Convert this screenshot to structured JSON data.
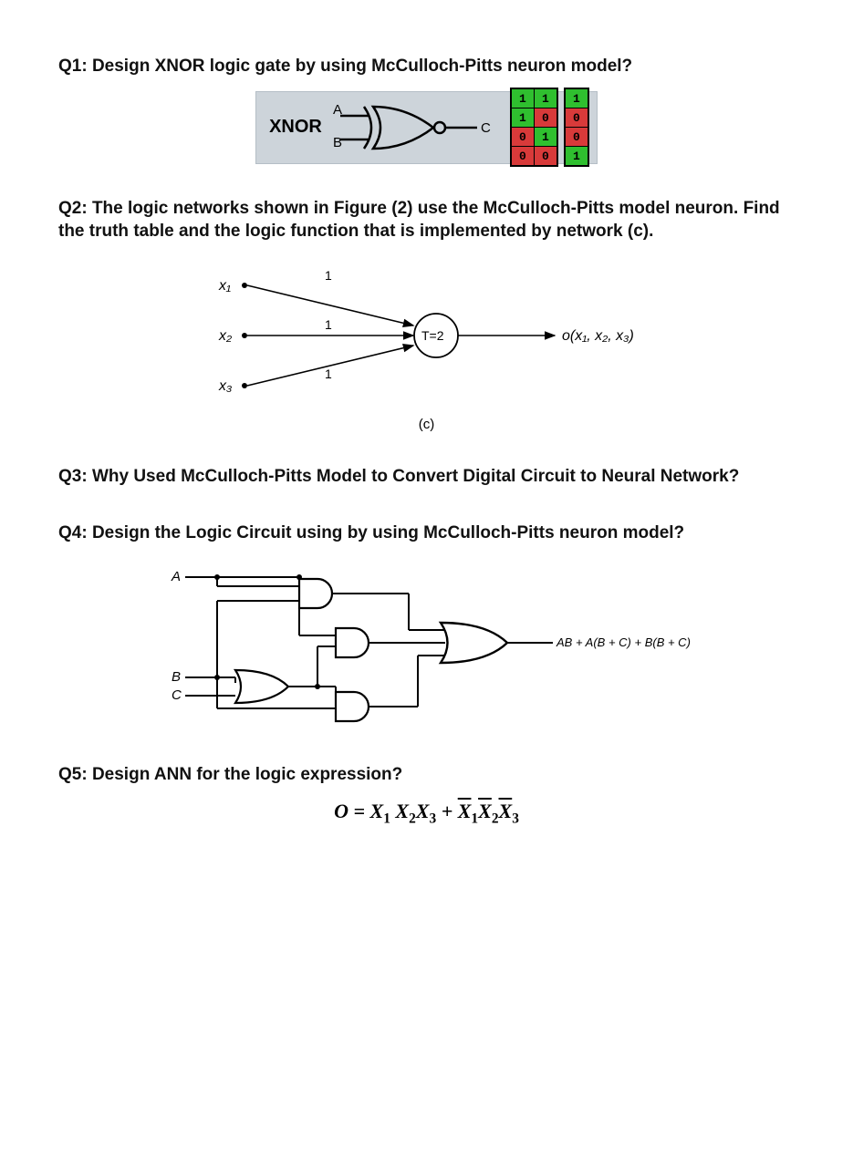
{
  "q1": {
    "title": "Q1: Design XNOR logic gate by using McCulloch-Pitts neuron model?",
    "label": "XNOR",
    "inputs": {
      "a": "A",
      "b": "B"
    },
    "output": "C",
    "truth_table": {
      "inputs_rows": [
        [
          "1",
          "1"
        ],
        [
          "1",
          "0"
        ],
        [
          "0",
          "1"
        ],
        [
          "0",
          "0"
        ]
      ],
      "output_rows": [
        "1",
        "0",
        "0",
        "1"
      ]
    }
  },
  "q2": {
    "title": "Q2: The logic networks shown in Figure (2) use the McCulloch-Pitts model neuron. Find the truth table and the logic function that is implemented by network (c).",
    "inputs": {
      "x1": "x₁",
      "x2": "x₂",
      "x3": "x₃"
    },
    "weights": {
      "w1": "1",
      "w2": "1",
      "w3": "1"
    },
    "threshold": "T=2",
    "output_label": "o(x₁, x₂, x₃)",
    "caption": "(c)"
  },
  "q3": {
    "title": "Q3: Why Used McCulloch-Pitts Model to Convert Digital Circuit to Neural Network?"
  },
  "q4": {
    "title": "Q4: Design the Logic Circuit using by using McCulloch-Pitts neuron model?",
    "inputs": {
      "a": "A",
      "b": "B",
      "c": "C"
    },
    "output_expr": "AB + A(B + C) + B(B + C)"
  },
  "q5": {
    "title": "Q5: Design ANN for the logic expression?",
    "expression_html": "O = X<sub>1</sub> X<sub>2</sub>X<sub>3</sub> + <span class=\"overbar\">X</span><sub>1</sub><span class=\"overbar\">X</span><sub>2</sub><span class=\"overbar\">X</span><sub>3</sub>"
  }
}
